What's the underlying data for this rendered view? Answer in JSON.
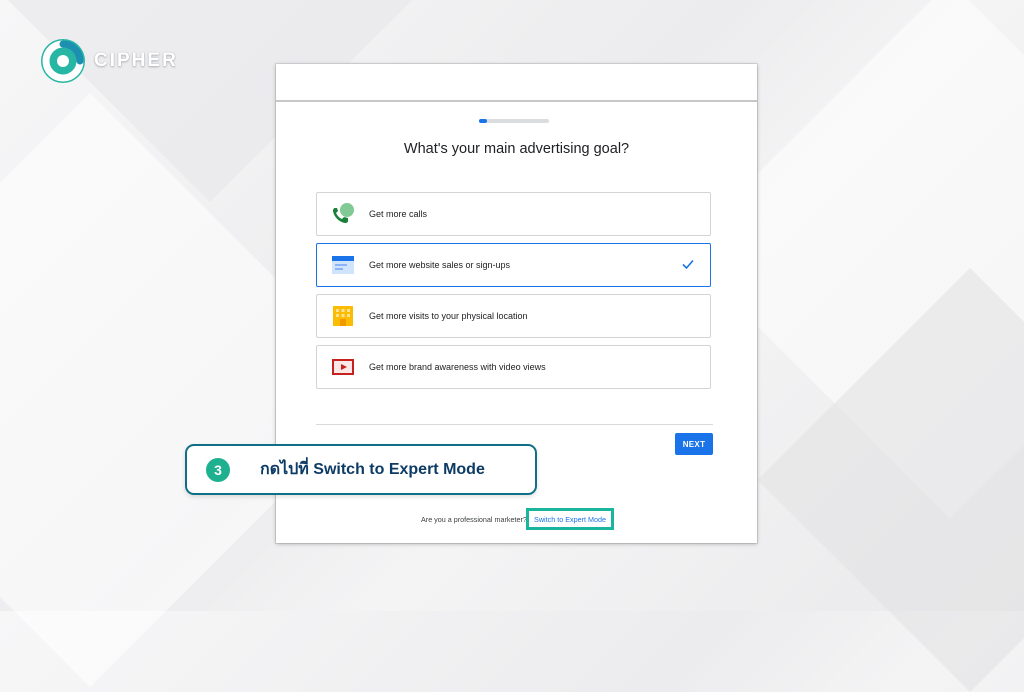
{
  "brand": {
    "name": "CIPHER"
  },
  "wizard": {
    "progress_fraction": 0.12,
    "question": "What's your main advertising goal?",
    "options": [
      {
        "label": "Get more calls",
        "icon": "phone-chat-icon",
        "selected": false
      },
      {
        "label": "Get more website sales or sign-ups",
        "icon": "browser-window-icon",
        "selected": true
      },
      {
        "label": "Get more visits to your physical location",
        "icon": "storefront-icon",
        "selected": false
      },
      {
        "label": "Get more brand awareness with video views",
        "icon": "video-play-icon",
        "selected": false
      }
    ],
    "next_label": "NEXT",
    "footer_prompt": "Are you a professional marketer?",
    "expert_mode_label": "Switch to Expert Mode"
  },
  "callout": {
    "step_number": "3",
    "text": "กดไปที่ Switch to Expert Mode",
    "border_color": "#0f6f86",
    "accent_color": "#1fb08f"
  },
  "colors": {
    "primary_blue": "#1a73e8",
    "highlight_teal": "#19b69d"
  }
}
